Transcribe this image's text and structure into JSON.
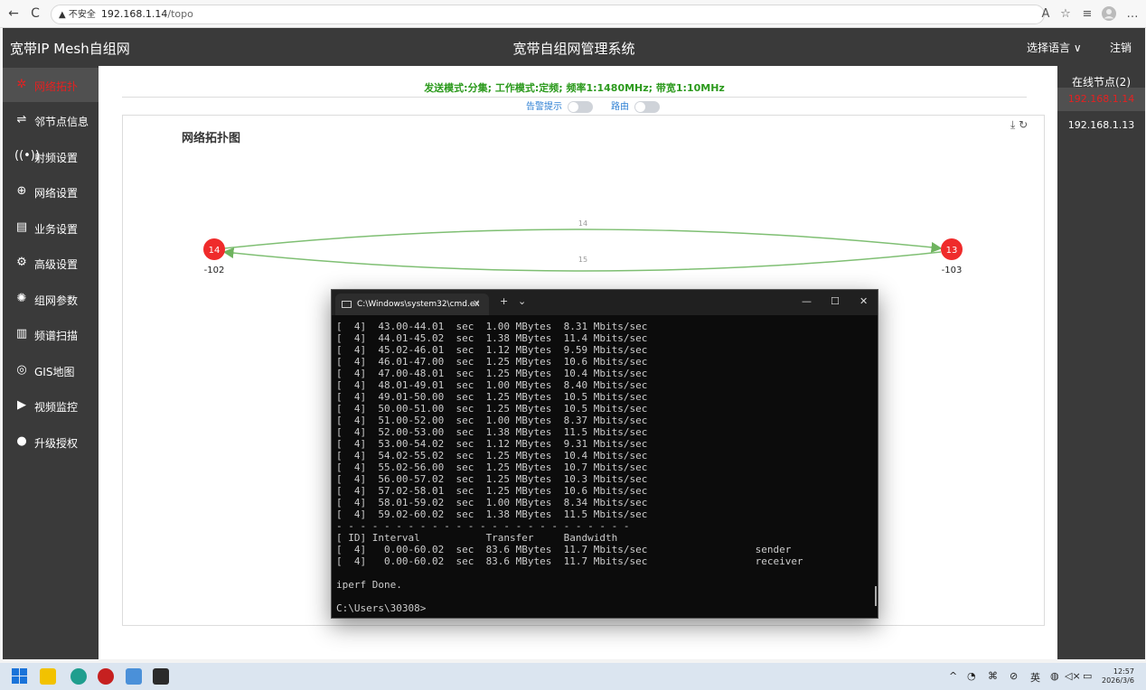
{
  "browser": {
    "back": "←",
    "reload": "C",
    "security_label": "▲ 不安全",
    "url": "192.168.1.14",
    "url_path": "/topo",
    "icons": [
      "read-aloud-icon",
      "favorite-icon",
      "collections-icon",
      "profile-icon",
      "more-icon"
    ]
  },
  "app": {
    "brand": "宽带IP Mesh自组网",
    "title": "宽带自组网管理系统",
    "language": "选择语言 ∨",
    "logout": "注销"
  },
  "sidebar": {
    "items": [
      {
        "label": "网络拓扑",
        "icon": "topology-icon",
        "active": true
      },
      {
        "label": "邻节点信息",
        "icon": "neighbor-icon",
        "active": false
      },
      {
        "label": "射频设置",
        "icon": "radio-icon",
        "active": false
      },
      {
        "label": "网络设置",
        "icon": "globe-icon",
        "active": false
      },
      {
        "label": "业务设置",
        "icon": "service-icon",
        "active": false
      },
      {
        "label": "高级设置",
        "icon": "gear-icon",
        "active": false
      },
      {
        "label": "组网参数",
        "icon": "network-params-icon",
        "active": false
      },
      {
        "label": "频谱扫描",
        "icon": "spectrum-icon",
        "active": false
      },
      {
        "label": "GIS地图",
        "icon": "map-pin-icon",
        "active": false
      },
      {
        "label": "视频监控",
        "icon": "camera-icon",
        "active": false
      },
      {
        "label": "升级授权",
        "icon": "upgrade-icon",
        "active": false
      }
    ]
  },
  "main": {
    "status_line": "发送模式:分集;  工作模式:定频;  频率1:1480MHz;  带宽1:10MHz",
    "toggles": {
      "alarm": "告警提示",
      "route": "路由"
    },
    "topo_title": "网络拓扑图",
    "nodes": [
      {
        "id": "14",
        "label": "-102"
      },
      {
        "id": "13",
        "label": "-103"
      }
    ],
    "links": [
      {
        "label": "14"
      },
      {
        "label": "15"
      }
    ]
  },
  "nodes_panel": {
    "header": "在线节点(2)",
    "items": [
      {
        "ip": "192.168.1.14",
        "active": true
      },
      {
        "ip": "192.168.1.13",
        "active": false
      }
    ]
  },
  "cmd": {
    "tab_title": "C:\\Windows\\system32\\cmd.ex",
    "lines": [
      "[  4]  43.00-44.01  sec  1.00 MBytes  8.31 Mbits/sec",
      "[  4]  44.01-45.02  sec  1.38 MBytes  11.4 Mbits/sec",
      "[  4]  45.02-46.01  sec  1.12 MBytes  9.59 Mbits/sec",
      "[  4]  46.01-47.00  sec  1.25 MBytes  10.6 Mbits/sec",
      "[  4]  47.00-48.01  sec  1.25 MBytes  10.4 Mbits/sec",
      "[  4]  48.01-49.01  sec  1.00 MBytes  8.40 Mbits/sec",
      "[  4]  49.01-50.00  sec  1.25 MBytes  10.5 Mbits/sec",
      "[  4]  50.00-51.00  sec  1.25 MBytes  10.5 Mbits/sec",
      "[  4]  51.00-52.00  sec  1.00 MBytes  8.37 Mbits/sec",
      "[  4]  52.00-53.00  sec  1.38 MBytes  11.5 Mbits/sec",
      "[  4]  53.00-54.02  sec  1.12 MBytes  9.31 Mbits/sec",
      "[  4]  54.02-55.02  sec  1.25 MBytes  10.4 Mbits/sec",
      "[  4]  55.02-56.00  sec  1.25 MBytes  10.7 Mbits/sec",
      "[  4]  56.00-57.02  sec  1.25 MBytes  10.3 Mbits/sec",
      "[  4]  57.02-58.01  sec  1.25 MBytes  10.6 Mbits/sec",
      "[  4]  58.01-59.02  sec  1.00 MBytes  8.34 Mbits/sec",
      "[  4]  59.02-60.02  sec  1.38 MBytes  11.5 Mbits/sec",
      "- - - - - - - - - - - - - - - - - - - - - - - - -",
      "[ ID] Interval           Transfer     Bandwidth",
      "[  4]   0.00-60.02  sec  83.6 MBytes  11.7 Mbits/sec                  sender",
      "[  4]   0.00-60.02  sec  83.6 MBytes  11.7 Mbits/sec                  receiver",
      "",
      "iperf Done.",
      "",
      "C:\\Users\\30308>"
    ]
  },
  "taskbar": {
    "tray": {
      "ime": "英",
      "time": "12:57",
      "date": "2026/3/6"
    }
  },
  "colors": {
    "header_bg": "#3a3a3a",
    "active_red": "#e52121",
    "status_green": "#2c9a1d",
    "link_green": "#7fbf73",
    "node_red": "#ef2b2b"
  }
}
